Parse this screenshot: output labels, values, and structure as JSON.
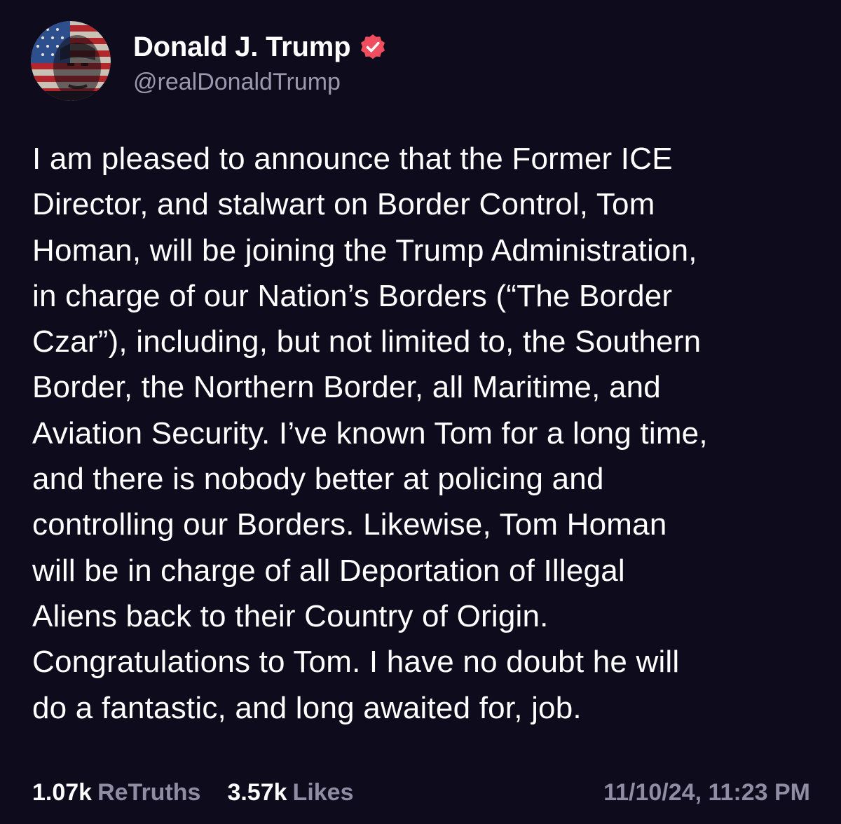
{
  "author": {
    "display_name": "Donald J. Trump",
    "handle": "@realDonaldTrump",
    "avatar_icon": "flag-portrait-avatar",
    "verified_icon": "verified-badge-icon",
    "verified_color": "#f04e5e"
  },
  "post": {
    "lines": [
      "I am pleased to announce that the Former ICE",
      "Director, and stalwart on Border Control, Tom",
      "Homan, will be joining the Trump Administration,",
      "in charge of our Nation’s Borders (“The Border",
      "Czar”), including, but not limited to, the Southern",
      "Border, the Northern Border, all Maritime, and",
      "Aviation Security. I’ve known Tom for a long time,",
      "and there is nobody better at policing and",
      "controlling our Borders. Likewise, Tom Homan",
      "will be in charge of all Deportation of Illegal",
      "Aliens back to their Country of Origin.",
      "Congratulations to Tom. I have no doubt he will",
      "do a fantastic, and long awaited for, job."
    ]
  },
  "stats": {
    "retruths_count": "1.07k",
    "retruths_label": "ReTruths",
    "likes_count": "3.57k",
    "likes_label": "Likes",
    "timestamp": "11/10/24, 11:23 PM"
  },
  "colors": {
    "background": "#0d0b1c",
    "muted_text": "#8f8ca3",
    "handle_text": "#9b98ac"
  }
}
